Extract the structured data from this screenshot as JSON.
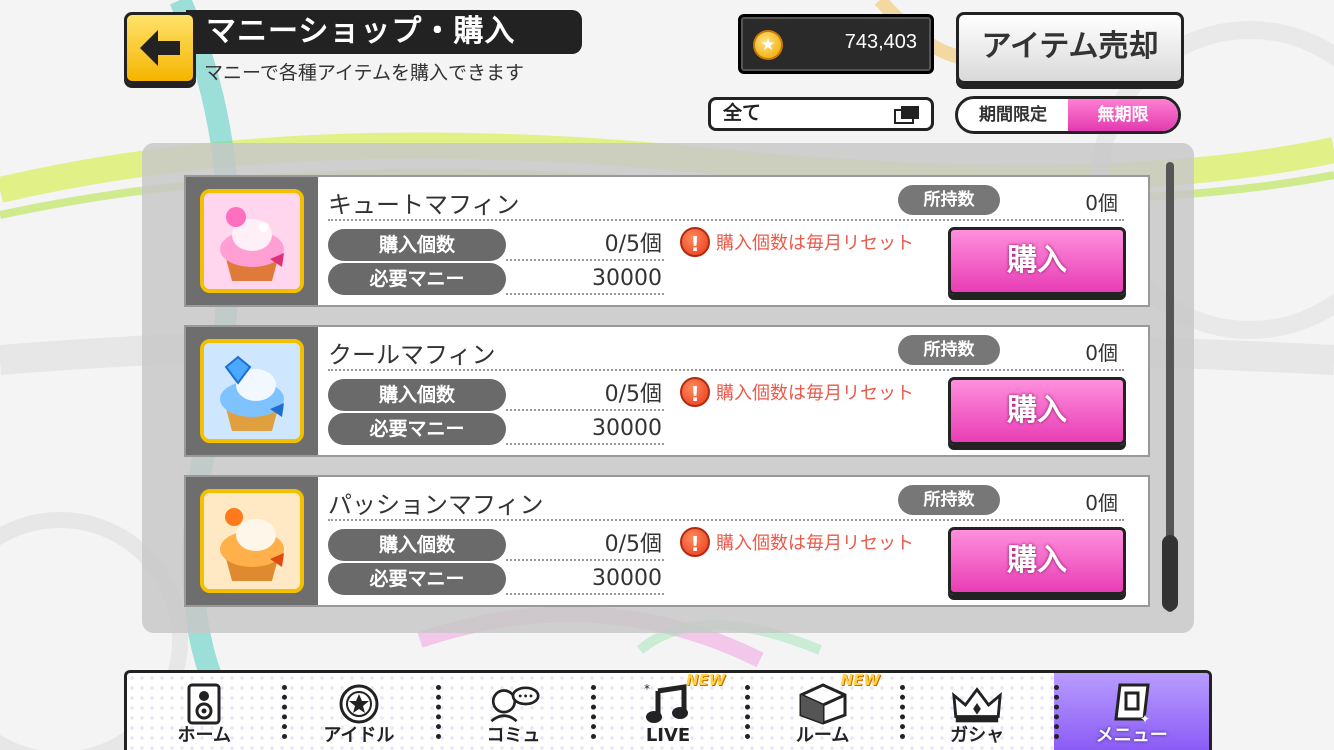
{
  "header": {
    "title": "マニーショップ・購入",
    "subtitle": "マニーで各種アイテムを購入できます",
    "money": "743,403",
    "sell_button": "アイテム売却",
    "filter_value": "全て",
    "period_options": [
      "期間限定",
      "無期限"
    ],
    "period_selected": "無期限"
  },
  "items": [
    {
      "name": "キュートマフィン",
      "owned_label": "所持数",
      "owned_value": "0個",
      "purchase_label": "購入個数",
      "purchase_value": "0/5個",
      "cost_label": "必要マニー",
      "cost_value": "30000",
      "notice": "購入個数は毎月リセット",
      "buy_label": "購入",
      "theme_color": "#ff6fbf"
    },
    {
      "name": "クールマフィン",
      "owned_label": "所持数",
      "owned_value": "0個",
      "purchase_label": "購入個数",
      "purchase_value": "0/5個",
      "cost_label": "必要マニー",
      "cost_value": "30000",
      "notice": "購入個数は毎月リセット",
      "buy_label": "購入",
      "theme_color": "#3f8dff"
    },
    {
      "name": "パッションマフィン",
      "owned_label": "所持数",
      "owned_value": "0個",
      "purchase_label": "購入個数",
      "purchase_value": "0/5個",
      "cost_label": "必要マニー",
      "cost_value": "30000",
      "notice": "購入個数は毎月リセット",
      "buy_label": "購入",
      "theme_color": "#ff9a2e"
    }
  ],
  "nav": {
    "items": [
      {
        "label": "ホーム",
        "icon": "speaker-icon",
        "new": ""
      },
      {
        "label": "アイドル",
        "icon": "star-medal-icon",
        "new": ""
      },
      {
        "label": "コミュ",
        "icon": "chat-person-icon",
        "new": ""
      },
      {
        "label": "LIVE",
        "icon": "music-note-icon",
        "new": "NEW"
      },
      {
        "label": "ルーム",
        "icon": "room-cube-icon",
        "new": "NEW"
      },
      {
        "label": "ガシャ",
        "icon": "crown-icon",
        "new": ""
      },
      {
        "label": "メニュー",
        "icon": "menu-card-icon",
        "new": ""
      }
    ],
    "active": "メニュー"
  },
  "colors": {
    "accent_pink": "#e83db5",
    "header_yellow": "#f5b400",
    "active_nav": "#8b5cf6"
  }
}
